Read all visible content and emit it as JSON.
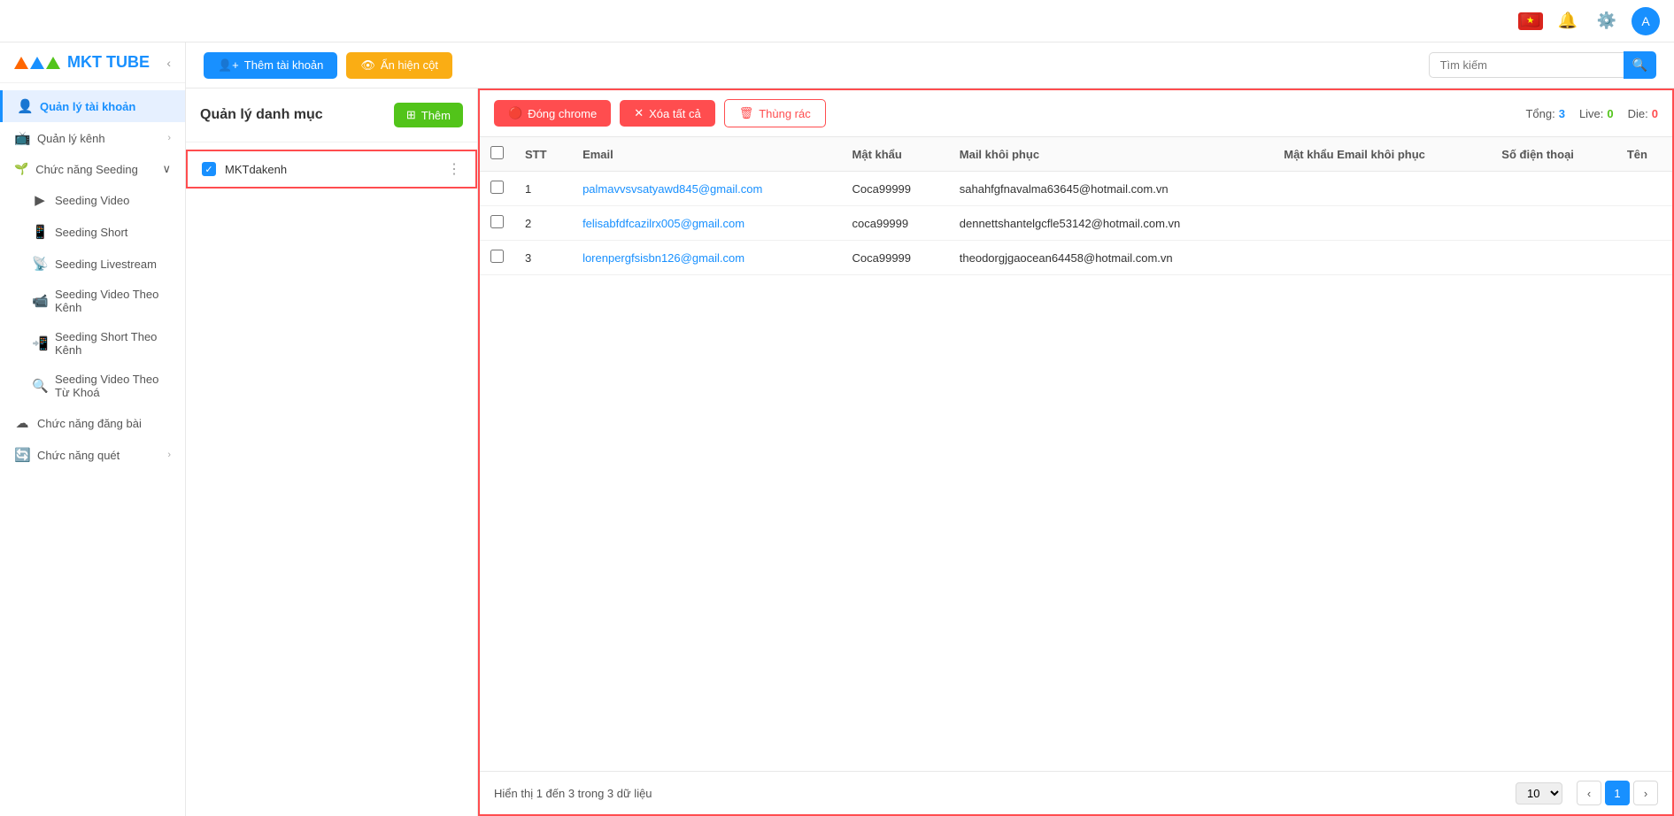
{
  "header": {
    "search_placeholder": "Tìm kiếm"
  },
  "sidebar": {
    "logo_text": "MKT TUBE",
    "menu_items": [
      {
        "id": "quan-ly-tai-khoan",
        "label": "Quản lý tài khoản",
        "icon": "👤",
        "active": true,
        "has_chevron": false
      },
      {
        "id": "quan-ly-kenh",
        "label": "Quản lý kênh",
        "icon": "📺",
        "has_chevron": true
      },
      {
        "id": "chuc-nang-seeding",
        "label": "Chức năng Seeding",
        "icon": "🌱",
        "has_chevron": true,
        "expanded": true
      },
      {
        "id": "seeding-video",
        "label": "Seeding Video",
        "icon": "▶",
        "sub": true
      },
      {
        "id": "seeding-short",
        "label": "Seeding Short",
        "icon": "📱",
        "sub": true
      },
      {
        "id": "seeding-livestream",
        "label": "Seeding Livestream",
        "icon": "📡",
        "sub": true
      },
      {
        "id": "seeding-video-theo-kenh",
        "label": "Seeding Video Theo Kênh",
        "icon": "📹",
        "sub": true
      },
      {
        "id": "seeding-short-theo-kenh",
        "label": "Seeding Short Theo Kênh",
        "icon": "📲",
        "sub": true
      },
      {
        "id": "seeding-video-theo-tu-khoa",
        "label": "Seeding Video Theo Từ Khoá",
        "icon": "🔍",
        "sub": true
      },
      {
        "id": "chuc-nang-dang-bai",
        "label": "Chức năng đăng bài",
        "icon": "☁",
        "has_chevron": false
      },
      {
        "id": "chuc-nang-quet",
        "label": "Chức năng quét",
        "icon": "🔄",
        "has_chevron": true
      }
    ]
  },
  "toolbar": {
    "add_account_label": "Thêm tài khoản",
    "hide_col_label": "Ẩn hiện cột"
  },
  "left_panel": {
    "title": "Quản lý danh mục",
    "add_label": "Thêm",
    "categories": [
      {
        "id": "mktdakenh",
        "name": "MKTdakenh",
        "selected": true
      }
    ]
  },
  "right_panel": {
    "buttons": {
      "dong_chrome": "Đóng chrome",
      "xoa_tat_ca": "Xóa tất cả",
      "thung_rac": "Thùng rác"
    },
    "stats": {
      "tong_label": "Tổng:",
      "tong_value": "3",
      "live_label": "Live:",
      "live_value": "0",
      "die_label": "Die:",
      "die_value": "0"
    },
    "table": {
      "columns": [
        "STT",
        "Email",
        "Mật khẩu",
        "Mail khôi phục",
        "Mật khẩu Email khôi phục",
        "Số điện thoại",
        "Tên"
      ],
      "rows": [
        {
          "stt": "1",
          "email": "palmavvsvsatyawd845@gmail.com",
          "password": "Coca99999",
          "recovery_mail": "sahahfgfnavalma63645@hotmail.com.vn",
          "recovery_password": "",
          "phone": "",
          "name": ""
        },
        {
          "stt": "2",
          "email": "felisabfdfcazilrx005@gmail.com",
          "password": "coca99999",
          "recovery_mail": "dennettshantelgcfle53142@hotmail.com.vn",
          "recovery_password": "",
          "phone": "",
          "name": ""
        },
        {
          "stt": "3",
          "email": "lorenpergfsisbn126@gmail.com",
          "password": "Coca99999",
          "recovery_mail": "theodorgjgaocean64458@hotmail.com.vn",
          "recovery_password": "",
          "phone": "",
          "name": ""
        }
      ]
    },
    "footer": {
      "info": "Hiển thị 1 đến 3 trong 3 dữ liệu",
      "page_size": "10",
      "current_page": "1"
    }
  }
}
